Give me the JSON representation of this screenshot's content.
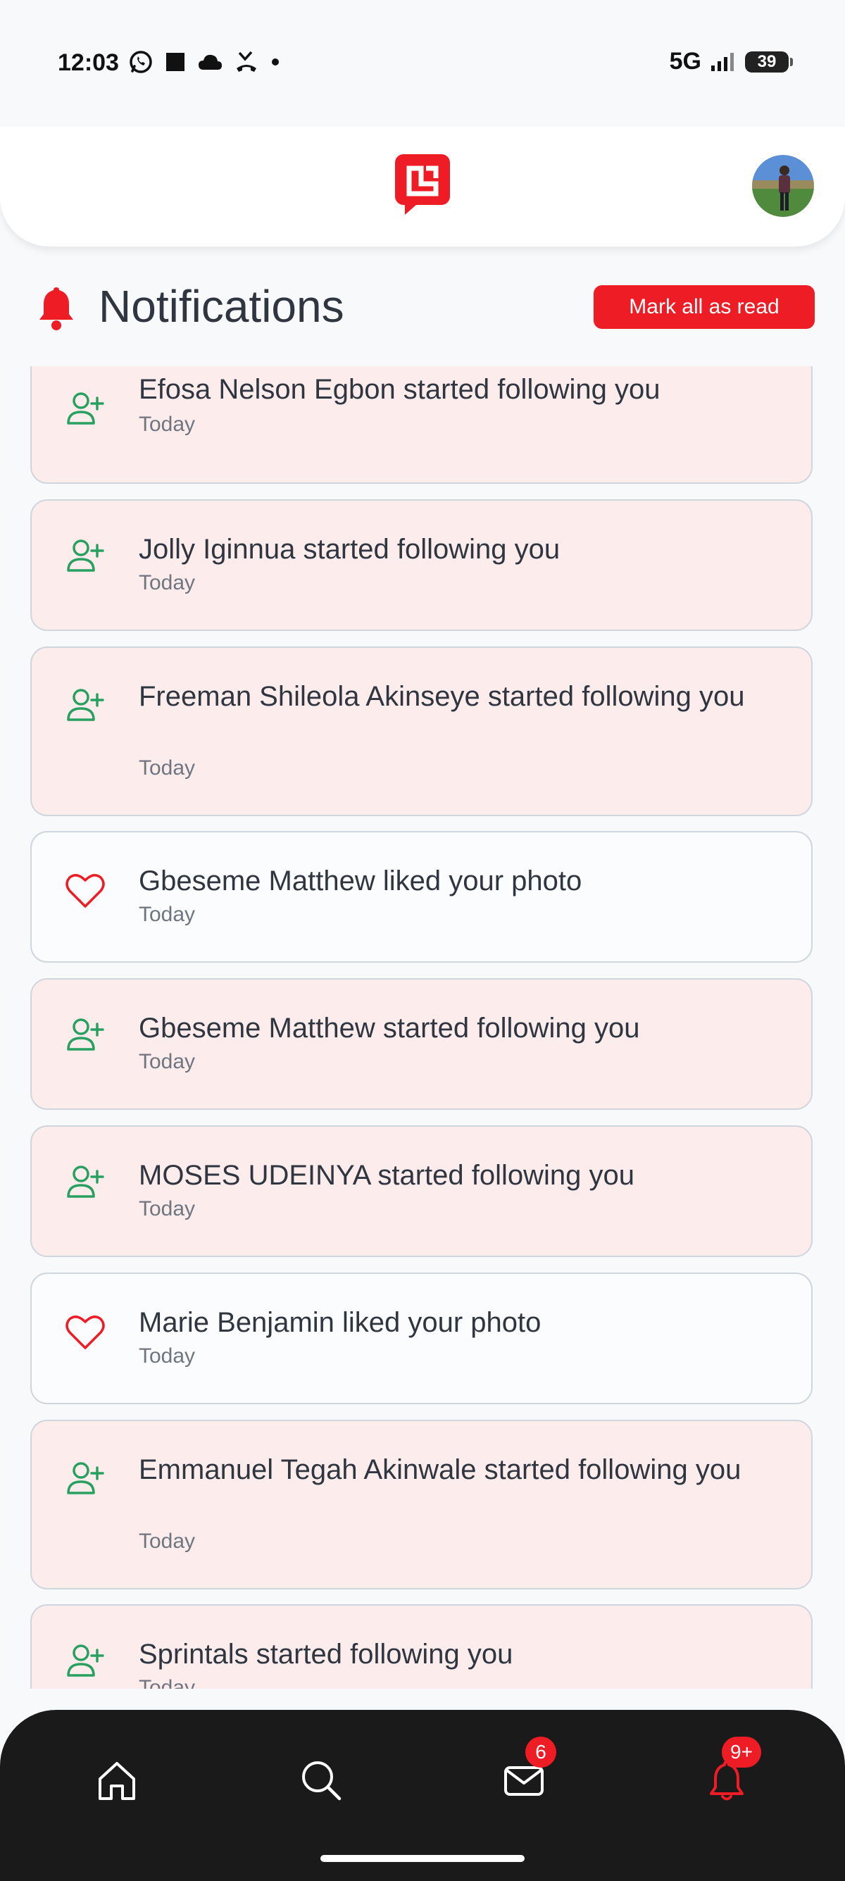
{
  "status_bar": {
    "time": "12:03",
    "network": "5G",
    "battery": "39"
  },
  "header": {
    "logo_icon": "app-logo-icon",
    "avatar_icon": "profile-avatar"
  },
  "page": {
    "title": "Notifications",
    "mark_all_label": "Mark all as read",
    "accent_color": "#ee1c25"
  },
  "notifications": [
    {
      "icon": "user-plus-icon",
      "text": "Efosa Nelson Egbon started following you",
      "time": "Today",
      "unread": true
    },
    {
      "icon": "user-plus-icon",
      "text": "Jolly Iginnua started following you",
      "time": "Today",
      "unread": true
    },
    {
      "icon": "user-plus-icon",
      "text": "Freeman Shileola Akinseye started following you",
      "time": "Today",
      "unread": true
    },
    {
      "icon": "heart-icon",
      "text": "Gbeseme Matthew liked your photo",
      "time": "Today",
      "unread": false
    },
    {
      "icon": "user-plus-icon",
      "text": "Gbeseme Matthew started following you",
      "time": "Today",
      "unread": true
    },
    {
      "icon": "user-plus-icon",
      "text": "MOSES UDEINYA started following you",
      "time": "Today",
      "unread": true
    },
    {
      "icon": "heart-icon",
      "text": "Marie Benjamin liked your photo",
      "time": "Today",
      "unread": false
    },
    {
      "icon": "user-plus-icon",
      "text": "Emmanuel Tegah Akinwale started following you",
      "time": "Today",
      "unread": true
    },
    {
      "icon": "user-plus-icon",
      "text": "Sprintals started following you",
      "time": "Today",
      "unread": true
    }
  ],
  "bottom_nav": {
    "home_icon": "home-icon",
    "search_icon": "search-icon",
    "messages_icon": "mail-icon",
    "messages_badge": "6",
    "notifications_icon": "bell-icon",
    "notifications_badge": "9+"
  }
}
